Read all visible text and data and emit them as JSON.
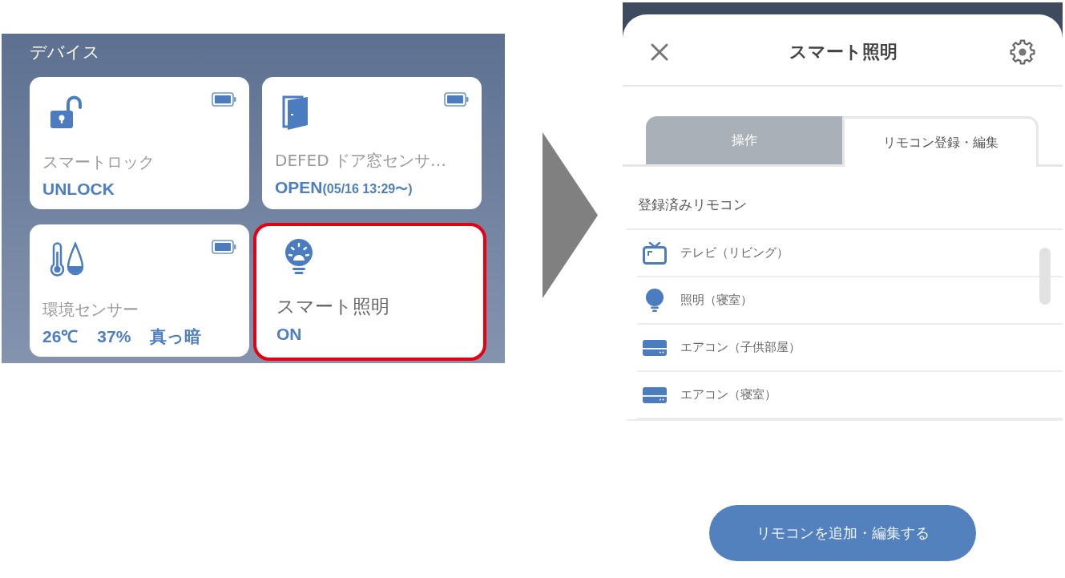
{
  "devices_panel": {
    "title": "デバイス",
    "cards": [
      {
        "kind": "lock",
        "name": "スマートロック",
        "status": [
          "UNLOCK"
        ],
        "battery": true,
        "highlighted": false
      },
      {
        "kind": "door",
        "name": "DEFED ドア窓センサ…",
        "status": [
          "OPEN"
        ],
        "since": "(05/16 13:29〜)",
        "battery": true,
        "highlighted": false
      },
      {
        "kind": "climate",
        "name": "環境センサー",
        "status": [
          "26℃",
          "37%",
          "真っ暗"
        ],
        "battery": true,
        "highlighted": false
      },
      {
        "kind": "light",
        "name": "スマート照明",
        "status": [
          "ON"
        ],
        "battery": false,
        "highlighted": true
      }
    ]
  },
  "remote_sheet": {
    "title": "スマート照明",
    "tabs": [
      {
        "label": "操作",
        "selected": false
      },
      {
        "label": "リモコン登録・編集",
        "selected": true
      }
    ],
    "section_title": "登録済みリモコン",
    "remotes": [
      {
        "kind": "tv",
        "name": "テレビ（リビング）"
      },
      {
        "kind": "light",
        "name": "照明（寝室）"
      },
      {
        "kind": "aircon",
        "name": "エアコン（子供部屋）"
      },
      {
        "kind": "aircon",
        "name": "エアコン（寝室）"
      }
    ],
    "add_button": "リモコンを追加・編集する"
  }
}
